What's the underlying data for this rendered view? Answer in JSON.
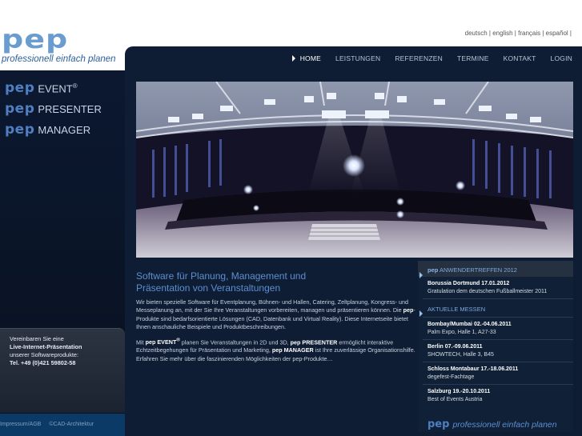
{
  "brand": {
    "logo_text": "pep",
    "tagline": "professionell einfach planen"
  },
  "languages": [
    "deutsch",
    "english",
    "français",
    "español"
  ],
  "lang_sep": " | ",
  "nav": [
    {
      "label": "HOME",
      "active": true
    },
    {
      "label": "LEISTUNGEN"
    },
    {
      "label": "REFERENZEN"
    },
    {
      "label": "TERMINE"
    },
    {
      "label": "KONTAKT"
    },
    {
      "label": "LOGIN"
    }
  ],
  "products": [
    {
      "prefix": "pep",
      "name": "EVENT",
      "sup": "®"
    },
    {
      "prefix": "pep",
      "name": "PRESENTER",
      "sup": ""
    },
    {
      "prefix": "pep",
      "name": "MANAGER",
      "sup": ""
    }
  ],
  "contact": {
    "line1": "Vereinbaren Sie eine",
    "line2": "Live-Internet-Präsentation",
    "line3": "unserer Softwareprodukte:",
    "phone": "Tel. +49 (0)421 59802-58"
  },
  "footer_left": {
    "impressum": "Impressum/AGB",
    "copyright": "©CAD-Architektur"
  },
  "main": {
    "headline_1": "Software für Planung, Management und",
    "headline_2": "Präsentation von Veranstaltungen",
    "p1": "Wir bieten spezielle Software für Eventplanung, Bühnen- und Hallen, Catering, Zeltplanung, Kongress- und Messeplanung an, mit der Sie Ihre Veranstaltungen vorbereiten, managen und präsentieren können. Die",
    "p1_bold": "pep",
    "p1_rest": "-Produkte sind bedarfsorientierte Lösungen (CAD, Datenbank und Virtual Reality). Diese Internetseite bietet Ihnen anschauliche Beispiele und Produktbeschreibungen.",
    "p2_a": "Mit",
    "p2_b": "pep EVENT",
    "p2_b_sup": "®",
    "p2_c": "planen Sie Veranstaltungen in 2D und 3D,",
    "p2_d": "pep PRESENTER",
    "p2_e": "ermöglicht interaktive Echtzeitbegehungen für Präsentation und Marketing,",
    "p2_f": "pep MANAGER",
    "p2_g": "ist Ihre zuverlässige Organisationshilfe. Erfahren Sie mehr über die faszinierenden Möglichkeiten der pep-Produkte…"
  },
  "news": {
    "head_prefix": "pep",
    "head_title": "ANWENDERTREFFEN 2012",
    "top_item": {
      "title": "Borussia Dortmund 17.01.2012",
      "desc": "Gratulation dem deutschen Fußballmeister 2011"
    },
    "section": "AKTUELLE MESSEN",
    "items": [
      {
        "title": "Bombay/Mumbai 02.-04.06.2011",
        "desc": "Palm Expo, Halle 1, A27-33"
      },
      {
        "title": "Berlin 07.-09.06.2011",
        "desc": "SHOWTECH, Halle 3, B45"
      },
      {
        "title": "Schloss Montabaur 17.-18.06.2011",
        "desc": "degefest-Fachtage"
      },
      {
        "title": "Salzburg 19.-20.10.2011",
        "desc": "Best of Events Austria"
      }
    ]
  },
  "footer_main": {
    "prefix": "pep",
    "tagline": "professionell einfach planen"
  },
  "colors": {
    "accent": "#5b8fd0",
    "panel": "#0e1d34",
    "nav_text": "#b9c4d4"
  }
}
